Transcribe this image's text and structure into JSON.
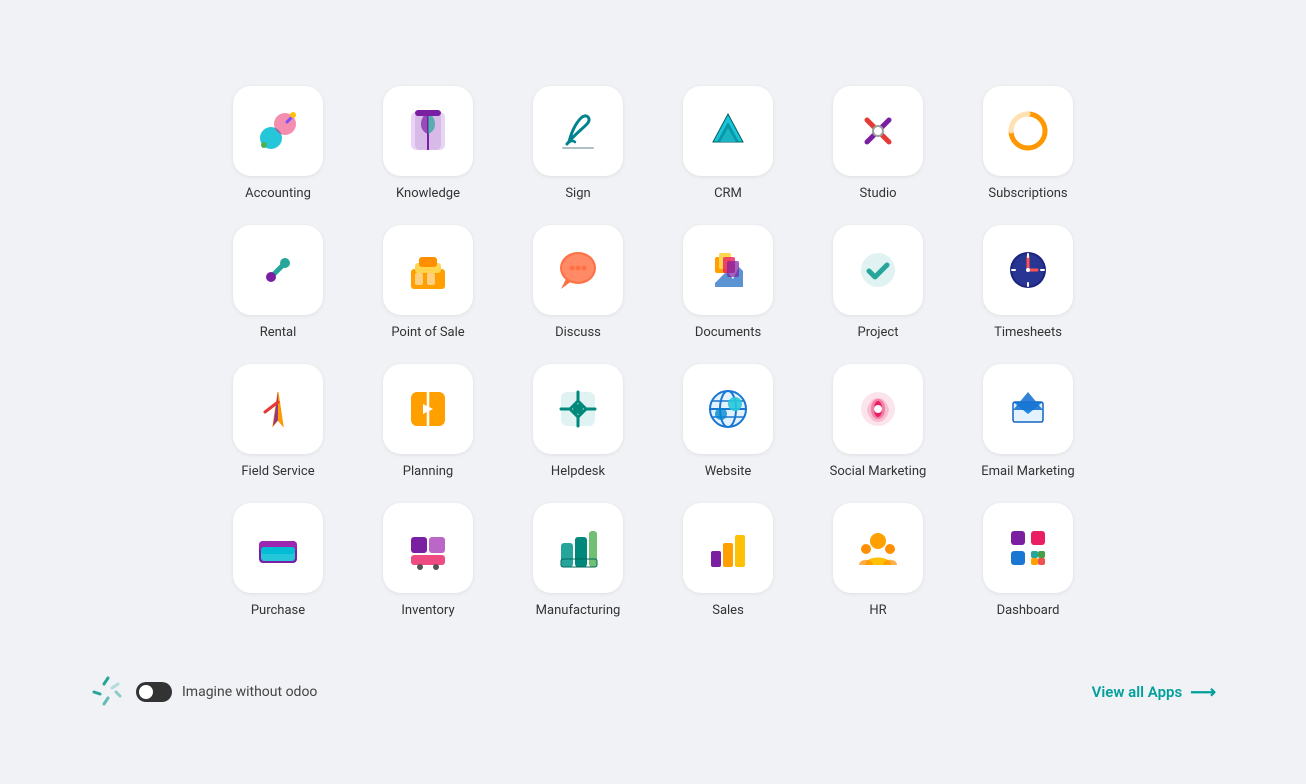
{
  "apps": [
    {
      "id": "accounting",
      "label": "Accounting"
    },
    {
      "id": "knowledge",
      "label": "Knowledge"
    },
    {
      "id": "sign",
      "label": "Sign"
    },
    {
      "id": "crm",
      "label": "CRM"
    },
    {
      "id": "studio",
      "label": "Studio"
    },
    {
      "id": "subscriptions",
      "label": "Subscriptions"
    },
    {
      "id": "rental",
      "label": "Rental"
    },
    {
      "id": "point-of-sale",
      "label": "Point of Sale"
    },
    {
      "id": "discuss",
      "label": "Discuss"
    },
    {
      "id": "documents",
      "label": "Documents"
    },
    {
      "id": "project",
      "label": "Project"
    },
    {
      "id": "timesheets",
      "label": "Timesheets"
    },
    {
      "id": "field-service",
      "label": "Field Service"
    },
    {
      "id": "planning",
      "label": "Planning"
    },
    {
      "id": "helpdesk",
      "label": "Helpdesk"
    },
    {
      "id": "website",
      "label": "Website"
    },
    {
      "id": "social-marketing",
      "label": "Social Marketing"
    },
    {
      "id": "email-marketing",
      "label": "Email Marketing"
    },
    {
      "id": "purchase",
      "label": "Purchase"
    },
    {
      "id": "inventory",
      "label": "Inventory"
    },
    {
      "id": "manufacturing",
      "label": "Manufacturing"
    },
    {
      "id": "sales",
      "label": "Sales"
    },
    {
      "id": "hr",
      "label": "HR"
    },
    {
      "id": "dashboard",
      "label": "Dashboard"
    }
  ],
  "bottom": {
    "toggle_label": "Imagine without odoo",
    "view_all_label": "View all Apps"
  }
}
